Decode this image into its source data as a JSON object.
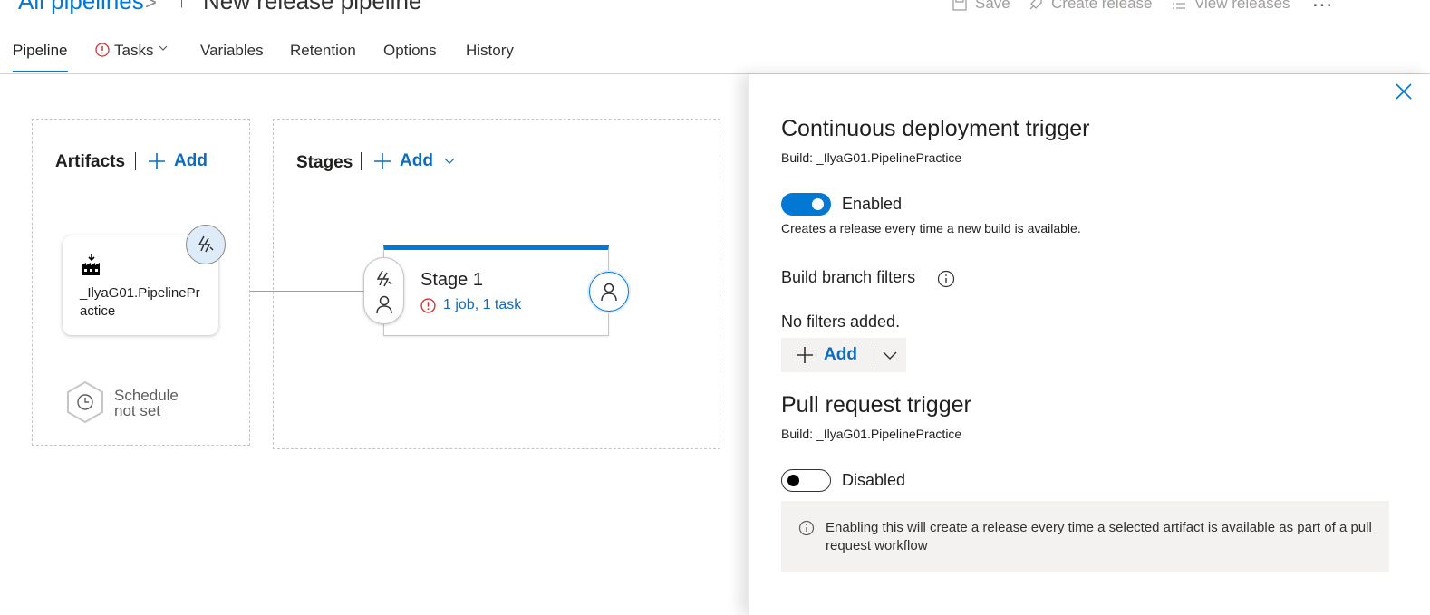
{
  "header": {
    "breadcrumb": "All pipelines",
    "breadcrumb_separator": ">",
    "pipeline_icon": "pipeline-up-arrow-icon",
    "title": "New release pipeline",
    "toolbar": {
      "save": "Save",
      "create_release": "Create release",
      "view_releases": "View releases",
      "more": "..."
    }
  },
  "tabs": [
    {
      "label": "Pipeline",
      "active": true
    },
    {
      "label": "Tasks",
      "warning": true,
      "dropdown": true
    },
    {
      "label": "Variables"
    },
    {
      "label": "Retention"
    },
    {
      "label": "Options"
    },
    {
      "label": "History"
    }
  ],
  "artifacts": {
    "title": "Artifacts",
    "add_label": "Add",
    "artifact_name": "_IlyaG01.PipelinePractice",
    "artifact_icon": "build-artifact-icon",
    "trigger_icon": "lightning-trigger-icon",
    "schedule_line1": "Schedule",
    "schedule_line2": "not set",
    "schedule_icon": "clock-icon"
  },
  "stages": {
    "title": "Stages",
    "add_label": "Add",
    "stage_name": "Stage 1",
    "stage_summary": "1 job, 1 task",
    "summary_icon": "error-circle-icon",
    "approver_icon": "person-icon"
  },
  "panel": {
    "cd_title": "Continuous deployment trigger",
    "cd_build": "Build: _IlyaG01.PipelinePractice",
    "cd_toggle_label": "Enabled",
    "cd_enabled": true,
    "cd_description": "Creates a release every time a new build is available.",
    "branch_filters_title": "Build branch filters",
    "no_filters": "No filters added.",
    "add_filter_label": "Add",
    "pr_title": "Pull request trigger",
    "pr_build": "Build: _IlyaG01.PipelinePractice",
    "pr_toggle_label": "Disabled",
    "pr_enabled": false,
    "pr_info": "Enabling this will create a release every time a selected artifact is available as part of a pull request workflow"
  },
  "colors": {
    "accent": "#0078d4",
    "link": "#0f6cbd",
    "error": "#d13438"
  }
}
